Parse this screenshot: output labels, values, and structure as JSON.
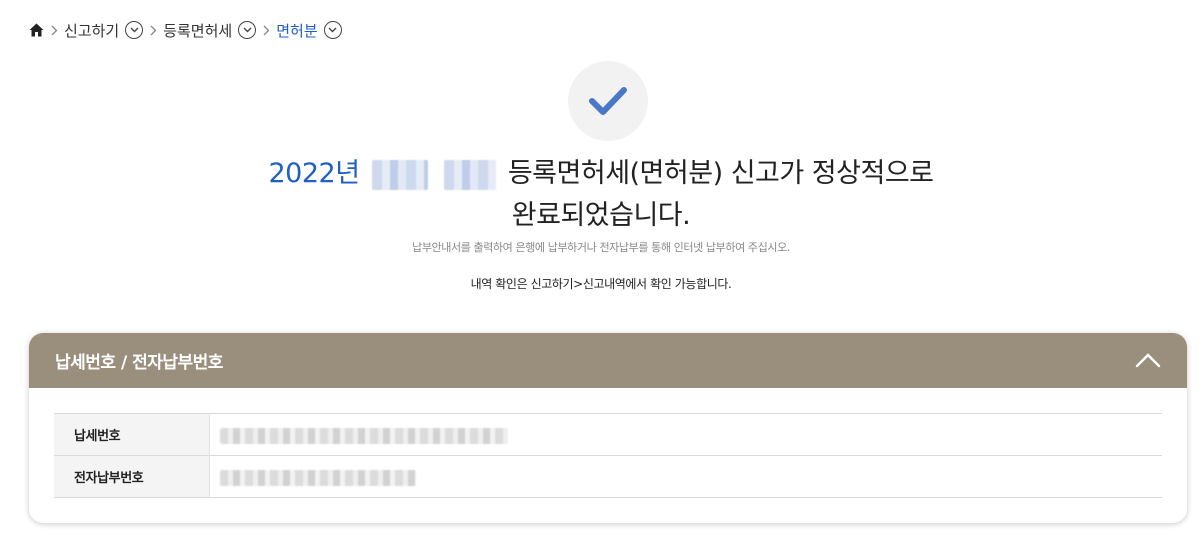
{
  "breadcrumb": {
    "items": [
      {
        "label": "신고하기"
      },
      {
        "label": "등록면허세"
      },
      {
        "label": "면허분"
      }
    ]
  },
  "message": {
    "year": "2022년",
    "line1_rest": "등록면허세(면허분) 신고가 정상적으로",
    "line2": "완료되었습니다.",
    "sub1": "납부안내서를 출력하여 은행에 납부하거나 전자납부를 통해 인터넷 납부하여 주십시오.",
    "sub2": "내역 확인은 신고하기>신고내역에서 확인 가능합니다."
  },
  "panel": {
    "title": "납세번호 / 전자납부번호",
    "rows": [
      {
        "label": "납세번호"
      },
      {
        "label": "전자납부번호"
      }
    ]
  },
  "colors": {
    "accent_blue": "#1f5fc6",
    "check_blue": "#4a78c9",
    "panel_header": "#9a8f7d"
  }
}
